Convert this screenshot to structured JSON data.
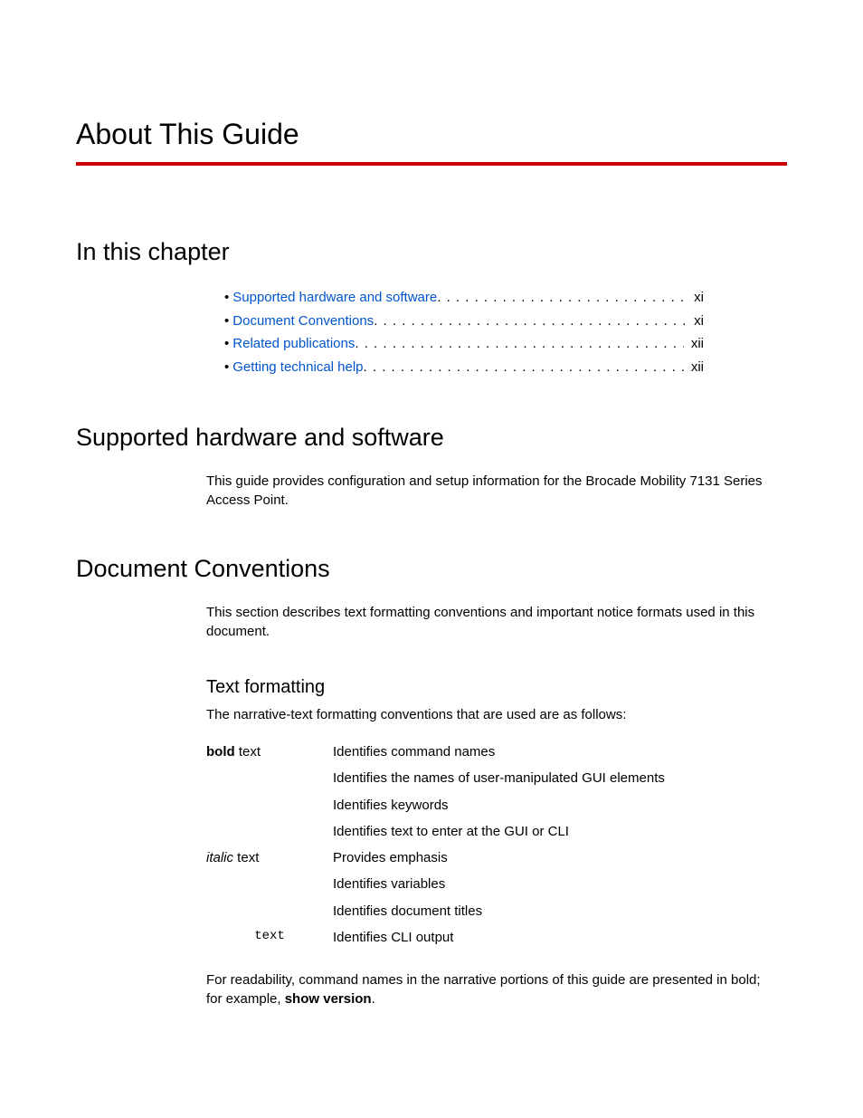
{
  "title": "About This Guide",
  "in_chapter_heading": "In this chapter",
  "toc": [
    {
      "label": "Supported hardware and software",
      "page": "xi"
    },
    {
      "label": "Document Conventions",
      "page": "xi"
    },
    {
      "label": "Related publications",
      "page": "xii"
    },
    {
      "label": "Getting technical help",
      "page": "xii"
    }
  ],
  "supported_heading": "Supported hardware and software",
  "supported_body": "This guide provides configuration and setup information for the Brocade Mobility 7131 Series Access Point.",
  "docconv_heading": "Document Conventions",
  "docconv_body": "This section describes text formatting conventions and important notice formats used in this document.",
  "textfmt_heading": "Text formatting",
  "textfmt_intro": "The narrative-text formatting conventions that are used are as follows:",
  "conv_bold_key_b": "bold",
  "conv_bold_key_rest": " text",
  "conv_bold_d1": "Identifies command names",
  "conv_bold_d2": "Identifies the names of user-manipulated GUI elements",
  "conv_bold_d3": "Identifies keywords",
  "conv_bold_d4": "Identifies text to enter at the GUI or CLI",
  "conv_italic_key_i": "italic",
  "conv_italic_key_rest": " text",
  "conv_italic_d1": "Provides emphasis",
  "conv_italic_d2": "Identifies variables",
  "conv_italic_d3": "Identifies document titles",
  "conv_mono_key": "text",
  "conv_mono_d1": "Identifies CLI output",
  "foot_pre": "For readability, command names in the narrative portions of this guide are presented in bold; for example, ",
  "foot_cmd": "show version",
  "foot_post": "."
}
